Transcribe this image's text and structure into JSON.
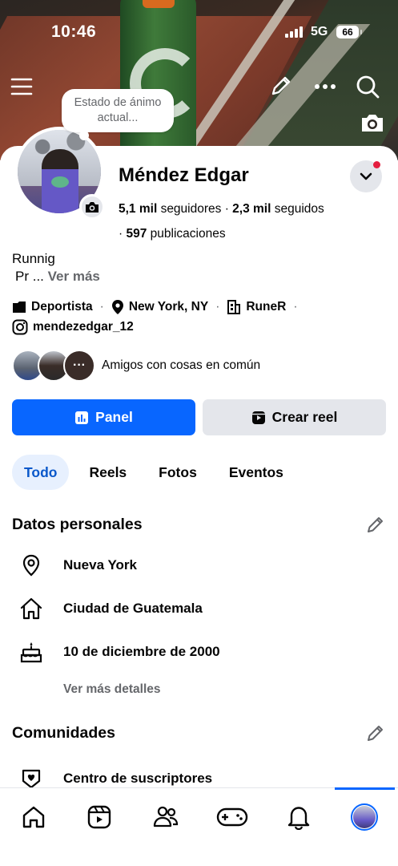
{
  "status_bar": {
    "time": "10:46",
    "network": "5G",
    "battery": "66"
  },
  "mood_bubble": {
    "text": "Estado de ánimo actual..."
  },
  "profile": {
    "name": "Méndez Edgar",
    "followers_count": "5,1 mil",
    "followers_label": "seguidores",
    "following_count": "2,3 mil",
    "following_label": "seguidos",
    "posts_count": "597",
    "posts_label": "publicaciones"
  },
  "bio": {
    "line1": "Runnig",
    "line2": "Pr ...",
    "see_more": "Ver más"
  },
  "info": {
    "category": "Deportista",
    "location": "New York, NY",
    "workplace": "RuneR",
    "instagram": "mendezedgar_12"
  },
  "mutual_friends": {
    "label": "Amigos con cosas en común",
    "more": "···"
  },
  "buttons": {
    "panel": "Panel",
    "create_reel": "Crear reel"
  },
  "tabs": [
    {
      "label": "Todo",
      "active": true
    },
    {
      "label": "Reels",
      "active": false
    },
    {
      "label": "Fotos",
      "active": false
    },
    {
      "label": "Eventos",
      "active": false
    }
  ],
  "personal_data": {
    "title": "Datos personales",
    "items": [
      {
        "icon": "location-pin-icon",
        "text": "Nueva York"
      },
      {
        "icon": "home-icon",
        "text": "Ciudad de Guatemala"
      },
      {
        "icon": "birthday-cake-icon",
        "text": "10 de diciembre de 2000"
      }
    ],
    "see_more": "Ver más detalles"
  },
  "communities": {
    "title": "Comunidades",
    "items": [
      {
        "icon": "subscriber-heart-icon",
        "text": "Centro de suscriptores"
      }
    ]
  },
  "bottom_nav": [
    {
      "icon": "home-icon"
    },
    {
      "icon": "reels-icon"
    },
    {
      "icon": "friends-icon"
    },
    {
      "icon": "gaming-icon"
    },
    {
      "icon": "notifications-bell-icon"
    },
    {
      "icon": "profile-avatar",
      "active": true
    }
  ],
  "colors": {
    "primary": "#0866ff",
    "secondary_button": "#e4e6eb",
    "muted_text": "#65676b",
    "active_tab_bg": "#e7f0fe",
    "notification_dot": "#e41e3f"
  }
}
